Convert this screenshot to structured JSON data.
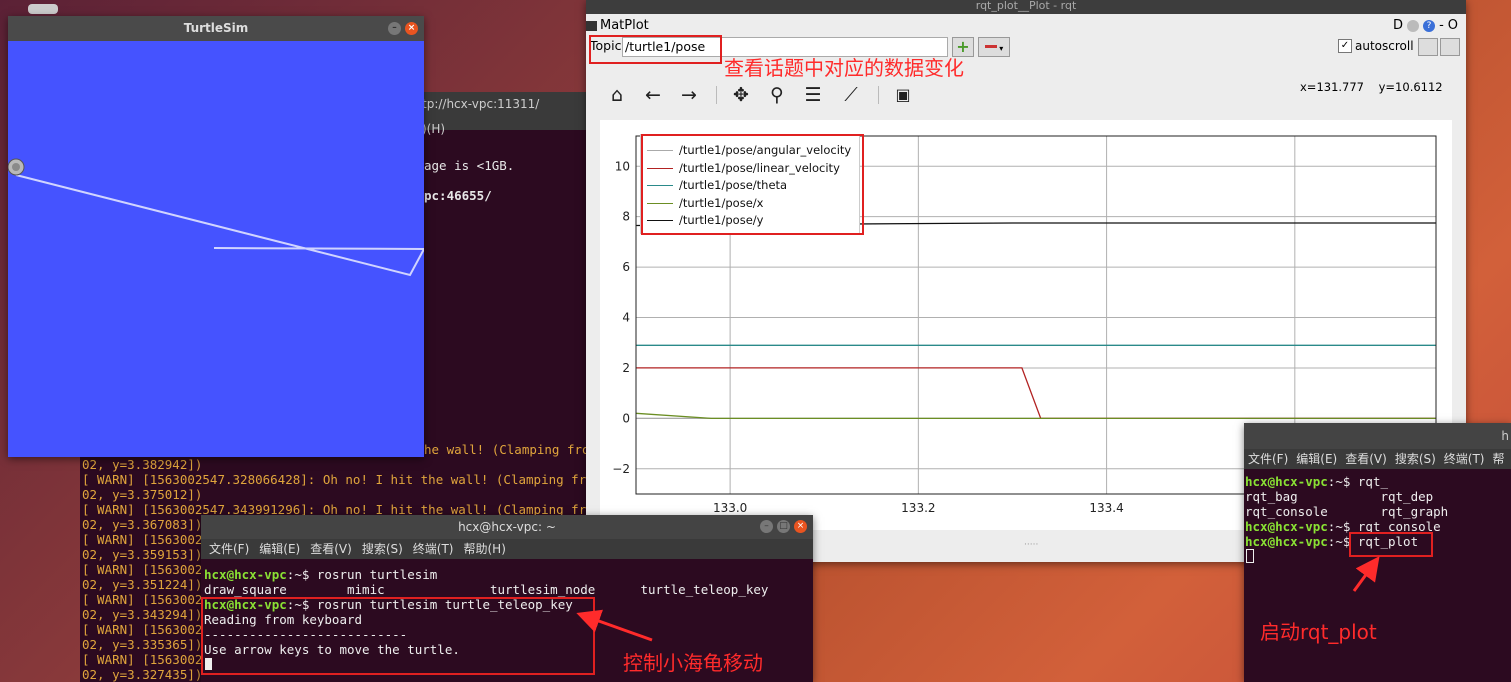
{
  "bg_terminal": {
    "url_fragment": "tp://hcx-vpc:11311/",
    "menu_fragment": ")(H)",
    "line1": "age is <1GB.",
    "line2": "pc:46655/",
    "wall_fragment": "he wall! (Clamping fro",
    "lines": [
      "02, y=3.382942])",
      "[ WARN] [1563002547.328066428]: Oh no! I hit the wall! (Clamping fro",
      "02, y=3.375012])",
      "[ WARN] [1563002547.343991296]: Oh no! I hit the wall! (Clamping fro",
      "02, y=3.367083])",
      "[ WARN] [156300254",
      "02, y=3.359153])",
      "[ WARN] [156300254",
      "02, y=3.351224])",
      "[ WARN] [156300254",
      "02, y=3.343294])",
      "[ WARN] [156300254",
      "02, y=3.335365])",
      "[ WARN] [156300254",
      "02, y=3.327435])"
    ]
  },
  "turtlesim": {
    "title": "TurtleSim",
    "bg_color": "#4553ff"
  },
  "rqt": {
    "window_title": "rqt_plot__Plot - rqt",
    "plugin_title": "MatPlot",
    "plugin_controls": "D",
    "topic_label": "Topic",
    "topic_value": "/turtle1/pose",
    "autoscroll_label": "autoscroll",
    "coords": "x=131.777    y=10.6112",
    "toolbar_icons": [
      "home-icon",
      "back-arrow-icon",
      "forward-arrow-icon",
      "pan-icon",
      "zoom-icon",
      "configure-subplots-icon",
      "edit-curves-icon",
      "save-icon"
    ]
  },
  "chart_data": {
    "type": "line",
    "xlim": [
      132.9,
      133.75
    ],
    "ylim": [
      -3,
      11.2
    ],
    "xticks": [
      133.0,
      133.2,
      133.4,
      133.6
    ],
    "xtick_labels": [
      "133.0",
      "133.2",
      "133.4",
      "133.6"
    ],
    "yticks": [
      -2,
      0,
      2,
      4,
      6,
      8,
      10
    ],
    "grid": true,
    "legend_position": "top-left",
    "series": [
      {
        "name": "/turtle1/pose/angular_velocity",
        "color": "#aaaaaa",
        "points": [
          [
            132.9,
            0.0
          ],
          [
            133.75,
            0.0
          ]
        ]
      },
      {
        "name": "/turtle1/pose/linear_velocity",
        "color": "#b22222",
        "points": [
          [
            132.9,
            2.0
          ],
          [
            133.31,
            2.0
          ],
          [
            133.33,
            0.0
          ],
          [
            133.75,
            0.0
          ]
        ]
      },
      {
        "name": "/turtle1/pose/theta",
        "color": "#2a8a8a",
        "points": [
          [
            132.9,
            2.9
          ],
          [
            133.75,
            2.9
          ]
        ]
      },
      {
        "name": "/turtle1/pose/x",
        "color": "#6b8e23",
        "points": [
          [
            132.9,
            0.2
          ],
          [
            132.98,
            0.0
          ],
          [
            133.75,
            0.0
          ]
        ]
      },
      {
        "name": "/turtle1/pose/y",
        "color": "#111111",
        "points": [
          [
            132.9,
            7.65
          ],
          [
            133.1,
            7.7
          ],
          [
            133.3,
            7.75
          ],
          [
            133.75,
            7.75
          ]
        ]
      }
    ]
  },
  "term2": {
    "title": "hcx@hcx-vpc: ~",
    "menu": [
      "文件(F)",
      "编辑(E)",
      "查看(V)",
      "搜索(S)",
      "终端(T)",
      "帮助(H)"
    ],
    "prompt": "hcx@hcx-vpc",
    "path1": ":~$ rosrun turtlesim",
    "completions": "draw_square        mimic              turtlesim_node      turtle_teleop_key",
    "path2": ":~$ rosrun turtlesim turtle_teleop_key",
    "out1": "Reading from keyboard",
    "out2": "---------------------------",
    "out3": "Use arrow keys to move the turtle."
  },
  "term3": {
    "title_fragment": "h",
    "menu": [
      "文件(F)",
      "编辑(E)",
      "查看(V)",
      "搜索(S)",
      "终端(T)",
      "帮"
    ],
    "prompt": "hcx@hcx-vpc",
    "cmd1": ":~$ rqt_",
    "comp1": "rqt_bag           rqt_dep",
    "comp2": "rqt_console       rqt_graph",
    "cmd2": ":~$ rqt_console",
    "cmd3": ":~$ rqt_plot"
  },
  "annotations": {
    "topic_note": "查看话题中对应的数据变化",
    "teleop_note": "控制小海龟移动",
    "rqt_plot_note": "启动rqt_plot"
  }
}
